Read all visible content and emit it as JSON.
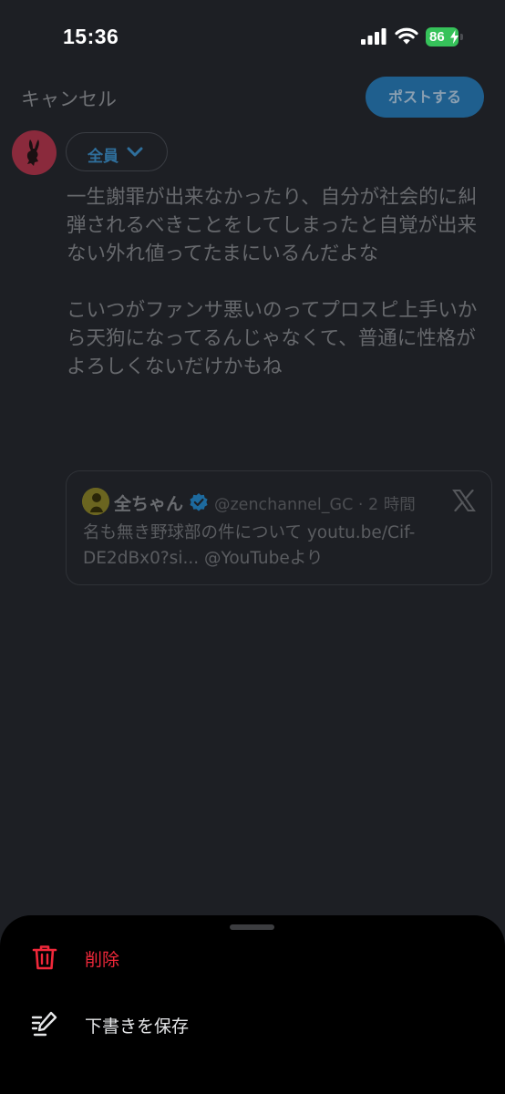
{
  "status_bar": {
    "time": "15:36",
    "battery": "86"
  },
  "header": {
    "cancel_label": "キャンセル",
    "post_label": "ポストする"
  },
  "audience": {
    "label": "全員"
  },
  "post": {
    "text": "一生謝罪が出来なかったり、自分が社会的に糾弾されるべきことをしてしまったと自覚が出来ない外れ値ってたまにいるんだよな\n\nこいつがファンサ悪いのってプロスピ上手いから天狗になってるんじゃなくて、普通に性格がよろしくないだけかもね"
  },
  "quote": {
    "name": "全ちゃん",
    "handle": "@zenchannel_GC · 2 時間",
    "text": "名も無き野球部の件について youtu.be/Cif-DE2dBx0?si... @YouTubeより"
  },
  "sheet": {
    "delete_label": "削除",
    "save_draft_label": "下書きを保存"
  },
  "colors": {
    "background": "#1d1f24",
    "accent_blue": "#1f5f8e",
    "delete_red": "#f0283a",
    "battery_green": "#36c25a"
  },
  "icons": {
    "signal": "signal-icon",
    "wifi": "wifi-icon",
    "audience_chevron": "chevron-down-icon",
    "verified": "verified-icon",
    "x_logo": "x-logo-icon",
    "delete": "trash-icon",
    "draft": "edit-icon"
  }
}
